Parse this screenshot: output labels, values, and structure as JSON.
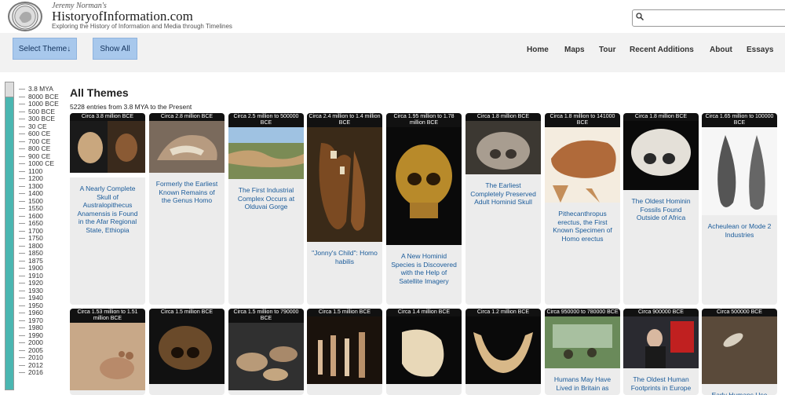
{
  "header": {
    "brand_top": "Jeremy Norman's",
    "brand_name": "HistoryofInformation.com",
    "brand_sub": "Exploring the History of Information and Media through Timelines"
  },
  "search": {
    "placeholder": ""
  },
  "nav": {
    "select_theme": "Select Theme↓",
    "show_all": "Show All",
    "links": [
      "Home",
      "Maps",
      "Tour",
      "Recent Additions",
      "About",
      "Essays"
    ]
  },
  "main": {
    "title": "All Themes",
    "count": "5228 entries from 3.8 MYA to the Present"
  },
  "timeline": [
    "3.8 MYA",
    "8000 BCE",
    "1000 BCE",
    "500 BCE",
    "300 BCE",
    "30 CE",
    "600 CE",
    "700 CE",
    "800 CE",
    "900 CE",
    "1000 CE",
    "1100",
    "1200",
    "1300",
    "1400",
    "1500",
    "1550",
    "1600",
    "1650",
    "1700",
    "1750",
    "1800",
    "1850",
    "1875",
    "1900",
    "1910",
    "1920",
    "1930",
    "1940",
    "1950",
    "1960",
    "1970",
    "1980",
    "1990",
    "2000",
    "2005",
    "2010",
    "2012",
    "2016"
  ],
  "cards_row1": [
    {
      "date": "Circa 3.8 million BCE",
      "title": "A Nearly Complete Skull of Australopithecus Anamensis is Found in the Afar Regional State, Ethiopia",
      "img": "skull-face"
    },
    {
      "date": "Circa 2.8 million BCE",
      "title": "Formerly the Earliest Known Remains of the Genus Homo",
      "img": "jaw-hand"
    },
    {
      "date": "Circa 2.5 million to 500000 BCE",
      "title": "The First Industrial Complex Occurs at Olduvai Gorge",
      "img": "gorge"
    },
    {
      "date": "Circa 2.4 million to 1.4 million BCE",
      "title": "\"Jonny's Child\": Homo habilis",
      "img": "jawbone"
    },
    {
      "date": "Circa 1.95 million to 1.78 million BCE",
      "title": "A New Hominid Species is Discovered with the Help of Satellite Imagery",
      "img": "gold-skull"
    },
    {
      "date": "Circa 1.8 million BCE",
      "title": "The Earliest Completely Preserved Adult Hominid Skull",
      "img": "gray-skull"
    },
    {
      "date": "Circa 1.8 million to 141000 BCE",
      "title": "Pithecanthropus erectus, the First Known Specimen of Homo erectus",
      "img": "skullcap"
    },
    {
      "date": "Circa 1.8 million BCE",
      "title": "The Oldest Hominin Fossils Found Outside of Africa",
      "img": "white-skull"
    },
    {
      "date": "Circa 1.65 million to 100000 BCE",
      "title": "Acheulean or Mode 2 Industries",
      "img": "handaxes"
    }
  ],
  "cards_row2": [
    {
      "date": "Circa 1.53 million to 1.51 million BCE",
      "title": "",
      "img": "footprint"
    },
    {
      "date": "Circa 1.5 million BCE",
      "title": "",
      "img": "dark-skull"
    },
    {
      "date": "Circa 1.5 million to 790000 BCE",
      "title": "",
      "img": "stones"
    },
    {
      "date": "Circa 1.5 million BCE",
      "title": "",
      "img": "bone-tools"
    },
    {
      "date": "Circa 1.4 million BCE",
      "title": "",
      "img": "flint"
    },
    {
      "date": "Circa 1.2 million BCE",
      "title": "",
      "img": "jaw-fragment"
    },
    {
      "date": "Circa 950000 to 780000 BCE",
      "title": "Humans May Have Lived in Britain as",
      "img": "museum"
    },
    {
      "date": "Circa 900000 BCE",
      "title": "The Oldest Human Footprints in Europe",
      "img": "presenter"
    },
    {
      "date": "Circa 500000 BCE",
      "title": "Early Humans Use",
      "img": "excavation"
    }
  ]
}
